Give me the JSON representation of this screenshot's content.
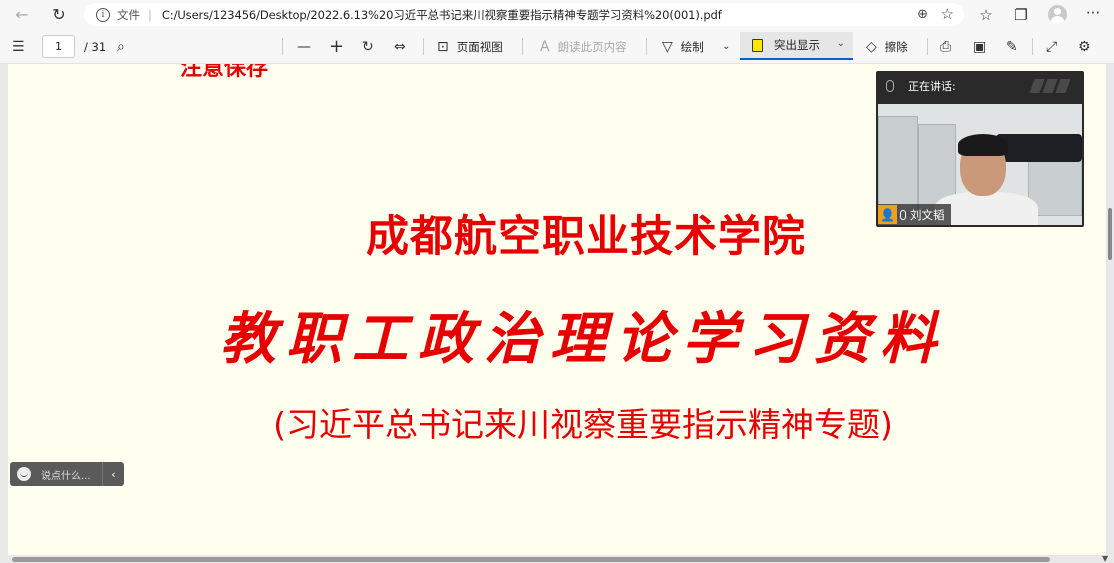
{
  "browser": {
    "nav": {
      "back_icon": "←",
      "refresh_icon": "↻"
    },
    "address": {
      "info_icon": "i",
      "scheme": "文件",
      "url": "C:/Users/123456/Desktop/2022.6.13%20习近平总书记来川视察重要指示精神专题学习资料%20(001).pdf",
      "zoom_icon": "⊕",
      "favorite_icon": "☆"
    },
    "right_icons": {
      "favorites_icon": "☆",
      "collections_icon": "❐",
      "more_icon": "···"
    }
  },
  "pdf_toolbar": {
    "contents_icon": "☰",
    "page_current": "1",
    "page_total": "/ 31",
    "search_icon": "⌕",
    "zoom_out_icon": "—",
    "zoom_in_icon": "+",
    "rotate_icon": "↻",
    "fit_icon": "⇔",
    "page_view_label": "页面视图",
    "read_aloud_label": "朗读此页内容",
    "draw_label": "绘制",
    "highlight_label": "突出显示",
    "erase_label": "擦除",
    "print_icon": "⎙",
    "save_icon": "▣",
    "save_as_icon": "✎",
    "fullscreen_icon": "⤢",
    "settings_icon": "⚙"
  },
  "document": {
    "cut_title": "注意保存",
    "institution": "成都航空职业技术学院",
    "title": "教职工政治理论学习资料",
    "subtitle": "(习近平总书记来川视察重要指示精神专题)"
  },
  "video": {
    "status": "正在讲话:",
    "speaker": "刘文韬"
  },
  "comment": {
    "placeholder": "说点什么...",
    "collapse_icon": "‹"
  }
}
